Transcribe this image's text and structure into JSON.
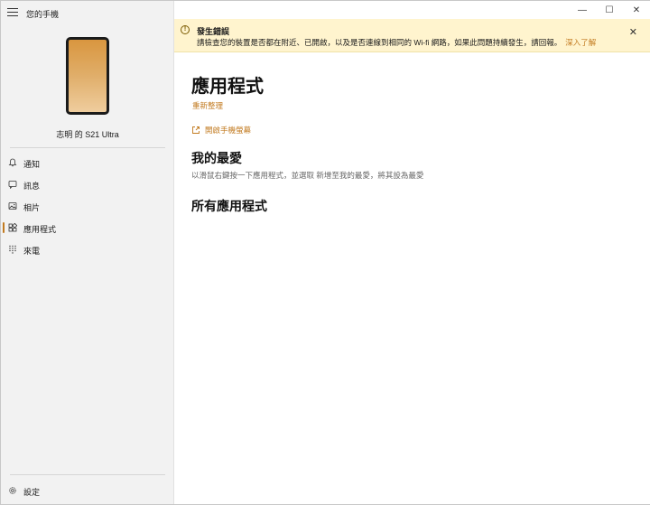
{
  "app": {
    "title": "您的手機"
  },
  "device": {
    "name": "志明 的 S21 Ultra"
  },
  "colors": {
    "accent": "#c27a1f",
    "banner_bg": "#fff4ce",
    "sidebar_bg": "#f2f2f2"
  },
  "sidebar": {
    "items": [
      {
        "label": "通知",
        "icon": "bell-icon"
      },
      {
        "label": "訊息",
        "icon": "message-icon"
      },
      {
        "label": "相片",
        "icon": "photo-icon"
      },
      {
        "label": "應用程式",
        "icon": "apps-icon",
        "active": true
      },
      {
        "label": "來電",
        "icon": "dialpad-icon"
      }
    ],
    "settings": {
      "label": "設定",
      "icon": "gear-icon"
    }
  },
  "window": {
    "minimize": "—",
    "maximize": "☐",
    "close": "✕"
  },
  "banner": {
    "icon": "warning-icon",
    "title": "發生錯誤",
    "message": "請檢查您的裝置是否都在附近、已開啟，以及是否連線到相同的 Wi-fi 網路，如果此問題持續發生，請回報。",
    "link": "深入了解",
    "close": "✕"
  },
  "main": {
    "title": "應用程式",
    "refresh": "重新整理",
    "open_screen": "開啟手機螢幕",
    "favorites_title": "我的最愛",
    "favorites_hint": "以滑鼠右鍵按一下應用程式，並選取 新增至我的最愛，將其設為最愛",
    "all_apps_title": "所有應用程式"
  }
}
